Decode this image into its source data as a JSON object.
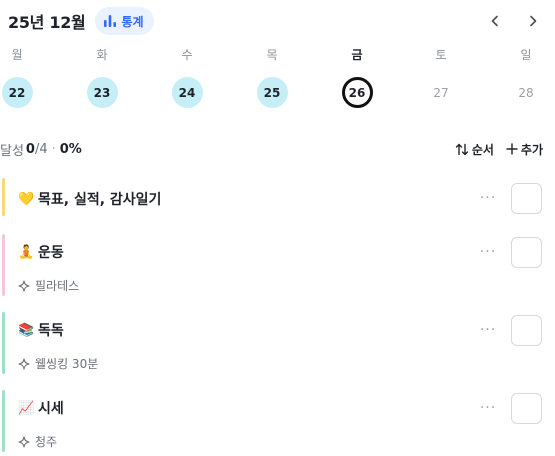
{
  "header": {
    "month_title": "25년 12월",
    "stats_label": "통계",
    "stats_icon": "bar-chart-icon",
    "prev_icon": "chevron-left-icon",
    "next_icon": "chevron-right-icon"
  },
  "week": {
    "days": [
      {
        "dow": "월",
        "date": "22",
        "state": "done"
      },
      {
        "dow": "화",
        "date": "23",
        "state": "done"
      },
      {
        "dow": "수",
        "date": "24",
        "state": "done"
      },
      {
        "dow": "목",
        "date": "25",
        "state": "done"
      },
      {
        "dow": "금",
        "date": "26",
        "state": "today"
      },
      {
        "dow": "토",
        "date": "27",
        "state": "future"
      },
      {
        "dow": "일",
        "date": "28",
        "state": "future"
      }
    ]
  },
  "progress": {
    "label": "달성",
    "count": "0",
    "total": "/4",
    "separator": "·",
    "percent": "0%",
    "sort_label": "순서",
    "add_label": "추가"
  },
  "tasks": [
    {
      "emoji": "💛",
      "title": "목표, 실적, 감사일기",
      "subtitle": "",
      "bar_color": "#f5d97a"
    },
    {
      "emoji": "🧘",
      "title": "운동",
      "subtitle": "필라테스",
      "bar_color": "#f3c6dc"
    },
    {
      "emoji": "📚",
      "title": "독독",
      "subtitle": "웰씽킹 30분",
      "bar_color": "#9fe0c8"
    },
    {
      "emoji": "📈",
      "title": "시세",
      "subtitle": "청주",
      "bar_color": "#9fe0c8"
    }
  ],
  "colors": {
    "accent": "#2f6bff",
    "done_circle": "#c6eef6",
    "today_ring": "#111111"
  }
}
